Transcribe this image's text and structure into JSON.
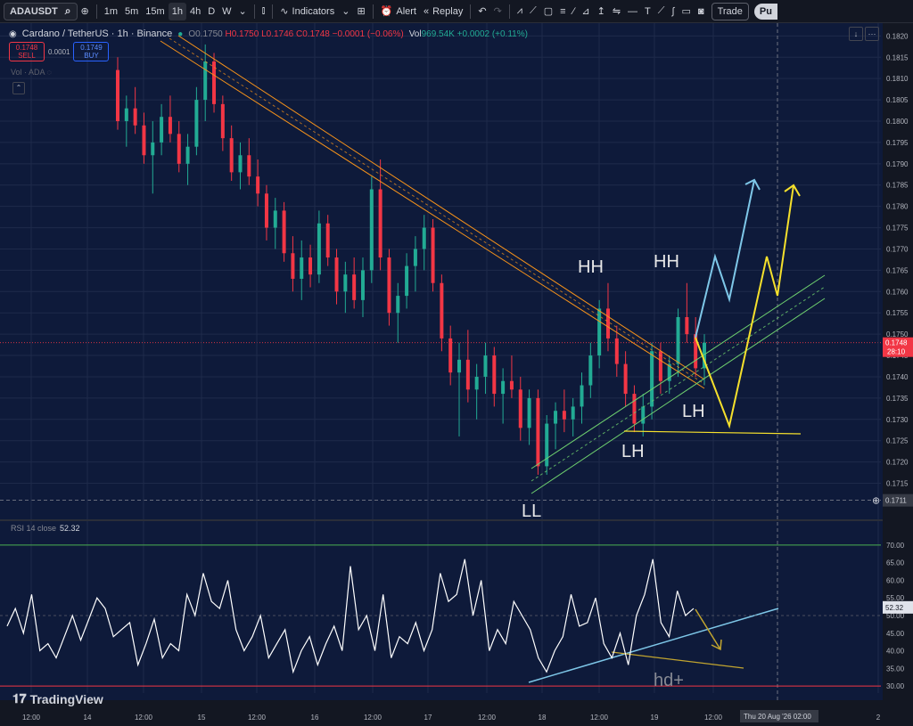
{
  "toolbar": {
    "symbol": "ADAUSDT",
    "timeframes": [
      "1m",
      "5m",
      "15m",
      "1h",
      "4h",
      "D",
      "W"
    ],
    "active_timeframe": "1h",
    "indicators_label": "Indicators",
    "alert_label": "Alert",
    "replay_label": "Replay",
    "trade_label": "Trade",
    "publish_label": "Pu"
  },
  "legend": {
    "title": "Cardano / TetherUS · 1h · Binance",
    "open": "O0.1750",
    "high": "H0.1750",
    "low": "L0.1746",
    "close": "C0.1748",
    "change": "−0.0001 (−0.06%)",
    "volume": "Vol",
    "volume_value": "969.54K",
    "volume_change": "+0.0002 (+0.11%)",
    "sell_price": "0.1748",
    "sell_label": "SELL",
    "spread": "0.0001",
    "buy_price": "0.1749",
    "buy_label": "BUY",
    "vol_indicator": "Vol · ADA"
  },
  "rsi": {
    "label": "RSI 14 close",
    "value": "52.32"
  },
  "branding": {
    "name": "TradingView"
  },
  "colors": {
    "bg": "#0e1a3a",
    "up": "#22ab94",
    "down": "#f23645",
    "orange": "#f7931a",
    "green": "#6fd16f",
    "yellow": "#f5e02c",
    "blue": "#7ec7e8"
  },
  "price_axis": {
    "labels": [
      "0.1820",
      "0.1815",
      "0.1810",
      "0.1805",
      "0.1800",
      "0.1795",
      "0.1790",
      "0.1785",
      "0.1780",
      "0.1775",
      "0.1770",
      "0.1765",
      "0.1760",
      "0.1755",
      "0.1750",
      "0.1745",
      "0.1740",
      "0.1735",
      "0.1730",
      "0.1725",
      "0.1720",
      "0.1715"
    ],
    "current_price": "0.1748",
    "countdown": "28:10",
    "crosshair_price": "0.1711"
  },
  "rsi_axis": {
    "labels": [
      "70.00",
      "65.00",
      "60.00",
      "55.00",
      "50.00",
      "45.00",
      "40.00",
      "35.00",
      "30.00"
    ],
    "current": "52.32"
  },
  "time_axis": {
    "labels": [
      "12:00",
      "14",
      "12:00",
      "15",
      "12:00",
      "16",
      "12:00",
      "17",
      "12:00",
      "18",
      "12:00",
      "19",
      "12:00",
      "2"
    ],
    "crosshair_time": "Thu 20 Aug '26",
    "crosshair_hour": "02:00"
  },
  "annotations": {
    "hh1": "HH",
    "hh2": "HH",
    "ll": "LL",
    "lh1": "LH",
    "lh2": "LH",
    "hd": "hd+"
  },
  "chart_data": {
    "type": "candlestick",
    "series": [
      {
        "values": [
          [
            0.1812,
            0.1815,
            0.1798,
            0.18
          ],
          [
            0.18,
            0.1806,
            0.1794,
            0.1803
          ],
          [
            0.1803,
            0.1808,
            0.1797,
            0.1799
          ],
          [
            0.1799,
            0.1802,
            0.179,
            0.1792
          ],
          [
            0.1792,
            0.18,
            0.1783,
            0.1795
          ],
          [
            0.1795,
            0.1804,
            0.1792,
            0.1801
          ],
          [
            0.1801,
            0.1806,
            0.1795,
            0.1797
          ],
          [
            0.1797,
            0.18,
            0.1788,
            0.179
          ],
          [
            0.179,
            0.1797,
            0.1785,
            0.1794
          ],
          [
            0.1794,
            0.1808,
            0.1792,
            0.1805
          ],
          [
            0.1805,
            0.1818,
            0.18,
            0.1814
          ],
          [
            0.1814,
            0.1816,
            0.1802,
            0.1804
          ],
          [
            0.1804,
            0.1806,
            0.1793,
            0.1796
          ],
          [
            0.1796,
            0.1799,
            0.1786,
            0.1788
          ],
          [
            0.1788,
            0.1795,
            0.1784,
            0.1792
          ],
          [
            0.1792,
            0.1796,
            0.1785,
            0.1787
          ],
          [
            0.1787,
            0.1791,
            0.178,
            0.1783
          ],
          [
            0.1783,
            0.1785,
            0.1772,
            0.1775
          ],
          [
            0.1775,
            0.1782,
            0.177,
            0.1779
          ],
          [
            0.1779,
            0.1781,
            0.1767,
            0.1769
          ],
          [
            0.1769,
            0.1773,
            0.176,
            0.1763
          ],
          [
            0.1763,
            0.1772,
            0.1758,
            0.1768
          ],
          [
            0.1768,
            0.1771,
            0.1761,
            0.1764
          ],
          [
            0.1764,
            0.1779,
            0.1762,
            0.1776
          ],
          [
            0.1776,
            0.1778,
            0.1766,
            0.1768
          ],
          [
            0.1768,
            0.177,
            0.1757,
            0.176
          ],
          [
            0.176,
            0.1767,
            0.1755,
            0.1764
          ],
          [
            0.1764,
            0.1768,
            0.1756,
            0.1758
          ],
          [
            0.1758,
            0.1768,
            0.1754,
            0.1765
          ],
          [
            0.1765,
            0.1787,
            0.1762,
            0.1784
          ],
          [
            0.1784,
            0.1791,
            0.1765,
            0.1768
          ],
          [
            0.1768,
            0.177,
            0.1752,
            0.1755
          ],
          [
            0.1755,
            0.1762,
            0.1748,
            0.1759
          ],
          [
            0.1759,
            0.1769,
            0.1756,
            0.1766
          ],
          [
            0.1766,
            0.1773,
            0.176,
            0.177
          ],
          [
            0.177,
            0.1778,
            0.1765,
            0.1775
          ],
          [
            0.1775,
            0.1777,
            0.176,
            0.1762
          ],
          [
            0.1762,
            0.1764,
            0.1746,
            0.1749
          ],
          [
            0.1749,
            0.1752,
            0.1738,
            0.1741
          ],
          [
            0.1741,
            0.1748,
            0.1726,
            0.1744
          ],
          [
            0.1744,
            0.1751,
            0.1734,
            0.1737
          ],
          [
            0.1737,
            0.1743,
            0.173,
            0.174
          ],
          [
            0.174,
            0.1748,
            0.1736,
            0.1745
          ],
          [
            0.1745,
            0.1747,
            0.1733,
            0.1736
          ],
          [
            0.1736,
            0.1742,
            0.1729,
            0.1739
          ],
          [
            0.1739,
            0.1745,
            0.1735,
            0.1737
          ],
          [
            0.1737,
            0.174,
            0.1725,
            0.1728
          ],
          [
            0.1728,
            0.1737,
            0.1724,
            0.1735
          ],
          [
            0.1735,
            0.1737,
            0.1717,
            0.1719
          ],
          [
            0.1719,
            0.1731,
            0.1717,
            0.1729
          ],
          [
            0.1729,
            0.1734,
            0.1723,
            0.1732
          ],
          [
            0.1732,
            0.1737,
            0.1727,
            0.173
          ],
          [
            0.173,
            0.1735,
            0.1726,
            0.1733
          ],
          [
            0.1733,
            0.1741,
            0.1729,
            0.1738
          ],
          [
            0.1738,
            0.1748,
            0.1735,
            0.1745
          ],
          [
            0.1745,
            0.1758,
            0.1742,
            0.1756
          ],
          [
            0.1756,
            0.1762,
            0.1746,
            0.1749
          ],
          [
            0.1749,
            0.1752,
            0.174,
            0.1743
          ],
          [
            0.1743,
            0.1746,
            0.1733,
            0.1736
          ],
          [
            0.1736,
            0.1738,
            0.1727,
            0.1729
          ],
          [
            0.1729,
            0.1736,
            0.1726,
            0.1733
          ],
          [
            0.1733,
            0.1748,
            0.173,
            0.1746
          ],
          [
            0.1746,
            0.1748,
            0.1736,
            0.1739
          ],
          [
            0.1739,
            0.1745,
            0.1736,
            0.1743
          ],
          [
            0.1743,
            0.1756,
            0.174,
            0.1754
          ],
          [
            0.1754,
            0.1762,
            0.1748,
            0.175
          ],
          [
            0.175,
            0.1754,
            0.174,
            0.1742
          ],
          [
            0.1742,
            0.175,
            0.1738,
            0.1748
          ]
        ]
      }
    ],
    "ylim": [
      0.1708,
      0.1823
    ]
  },
  "rsi_data": {
    "values": [
      47,
      52,
      45,
      56,
      40,
      42,
      38,
      44,
      50,
      43,
      49,
      55,
      52,
      44,
      46,
      48,
      36,
      42,
      49,
      38,
      42,
      40,
      56,
      50,
      62,
      54,
      52,
      60,
      46,
      40,
      44,
      50,
      38,
      42,
      46,
      34,
      40,
      44,
      36,
      42,
      47,
      40,
      64,
      46,
      50,
      40,
      56,
      38,
      44,
      42,
      48,
      40,
      46,
      62,
      54,
      56,
      66,
      50,
      60,
      40,
      46,
      42,
      54,
      50,
      46,
      38,
      34,
      40,
      44,
      56,
      47,
      48,
      55,
      42,
      38,
      45,
      36,
      50,
      56,
      66,
      48,
      44,
      57,
      50,
      52
    ],
    "ylim": [
      28,
      72
    ]
  }
}
